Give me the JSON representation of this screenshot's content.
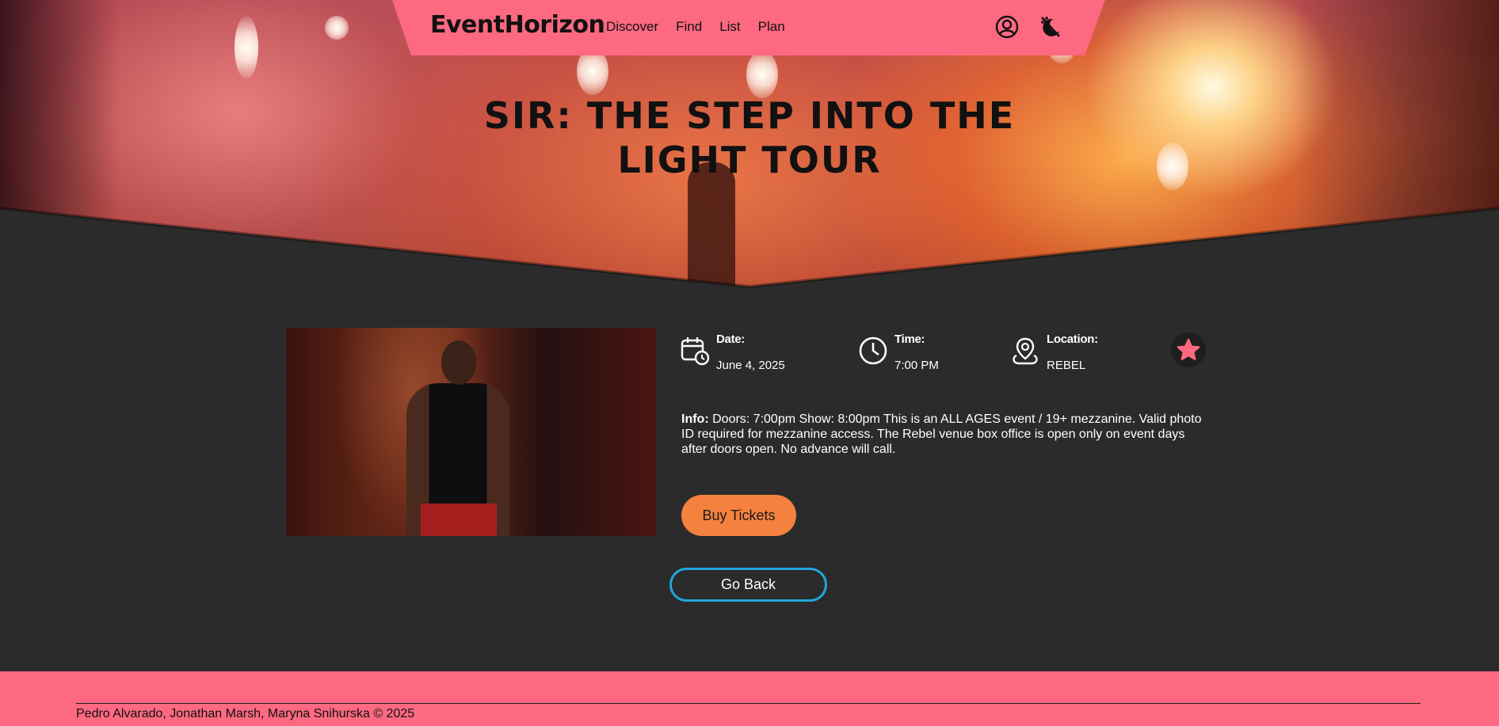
{
  "nav": {
    "brand": "EventHorizon",
    "links": [
      {
        "label": "Discover"
      },
      {
        "label": "Find"
      },
      {
        "label": "List"
      },
      {
        "label": "Plan"
      }
    ],
    "icons": [
      "user-profile-icon",
      "theme-toggle-icon"
    ]
  },
  "hero": {
    "title": "SIR: THE STEP INTO THE LIGHT TOUR"
  },
  "event": {
    "date_label": "Date:",
    "date_value": "June 4, 2025",
    "time_label": "Time:",
    "time_value": "7:00 PM",
    "location_label": "Location:",
    "location_value": "REBEL",
    "info_label": "Info:",
    "info_text": "Doors: 7:00pm Show: 8:00pm This is an ALL AGES event / 19+ mezzanine. Valid photo ID required for mezzanine access. The Rebel venue box office is open only on event days after doors open. No advance will call.",
    "buy_label": "Buy Tickets",
    "back_label": "Go Back"
  },
  "footer": {
    "credits": "Pedro Alvarado, Jonathan Marsh, Maryna Snihurska © 2025"
  },
  "colors": {
    "accent_pink": "#fd6981",
    "buy_orange": "#f5813f",
    "back_blue": "#1fa8d8",
    "background_dark": "#2b2b2b"
  }
}
